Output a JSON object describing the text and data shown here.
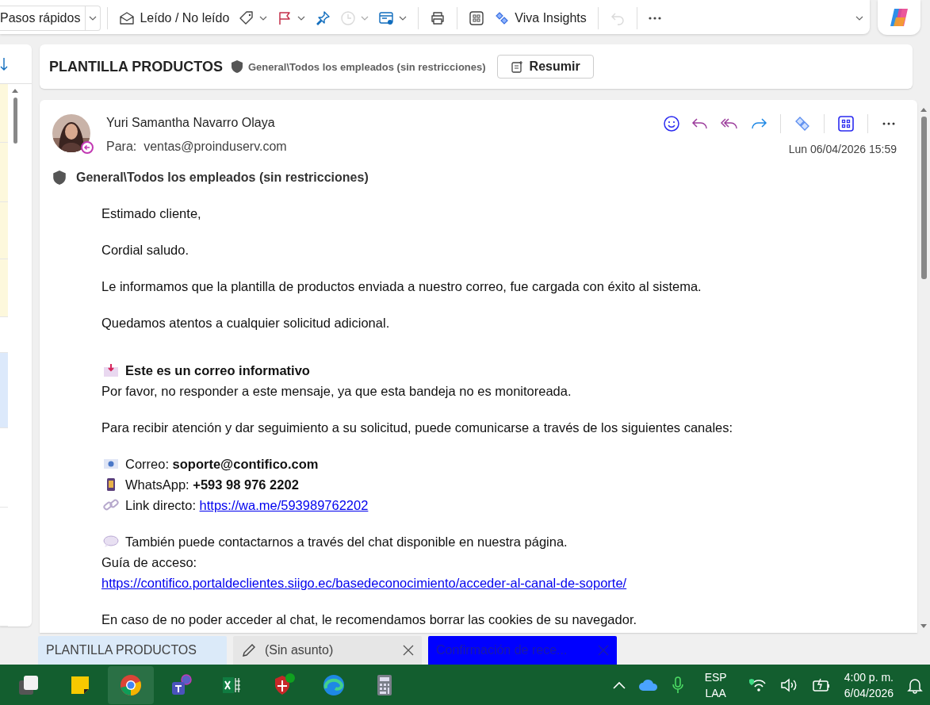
{
  "toolbar": {
    "groups": [
      {
        "items": [
          {
            "kind": "split",
            "label": "Pasos rápidos",
            "dropdown": true,
            "disabled": false
          }
        ]
      },
      {
        "items": [
          {
            "kind": "mail",
            "label": "Leído / No leído",
            "dropdown": false,
            "disabled": false
          },
          {
            "kind": "tag",
            "dropdown": true,
            "disabled": false
          },
          {
            "kind": "flag",
            "dropdown": true,
            "disabled": false
          },
          {
            "kind": "pin",
            "dropdown": false,
            "disabled": false
          },
          {
            "kind": "clock",
            "dropdown": true,
            "disabled": true
          },
          {
            "kind": "rules",
            "dropdown": true,
            "disabled": false
          }
        ]
      },
      {
        "items": [
          {
            "kind": "print",
            "dropdown": false,
            "disabled": false
          }
        ]
      },
      {
        "items": [
          {
            "kind": "apps",
            "dropdown": false,
            "disabled": false
          },
          {
            "kind": "viva",
            "label": "Viva Insights",
            "dropdown": false,
            "disabled": false
          }
        ]
      },
      {
        "items": [
          {
            "kind": "undo",
            "dropdown": false,
            "disabled": true
          }
        ]
      },
      {
        "items": [
          {
            "kind": "more",
            "dropdown": false,
            "disabled": false
          }
        ]
      }
    ]
  },
  "message_list": {
    "rows": [
      {
        "highlighted": true,
        "selected": false
      },
      {
        "highlighted": true,
        "selected": false
      },
      {
        "highlighted": true,
        "selected": false
      },
      {
        "highlighted": true,
        "selected": false
      },
      {
        "highlighted": false,
        "selected": false
      },
      {
        "highlighted": false,
        "selected": true
      },
      {
        "highlighted": false,
        "selected": false
      },
      {
        "highlighted": false,
        "selected": false
      }
    ]
  },
  "header": {
    "subject": "PLANTILLA PRODUCTOS",
    "sensitivity": "General\\Todos los empleados (sin restricciones)",
    "summarize_button": "Resumir"
  },
  "message": {
    "sender": "Yuri Samantha Navarro Olaya",
    "to_label": "Para:",
    "to": "ventas@proinduserv.com",
    "date": "Lun 06/04/2026 15:59",
    "sensitivity": "General\\Todos los empleados (sin restricciones)",
    "body": [
      {
        "lines": [
          {
            "kind": "text",
            "text": "Estimado cliente,"
          }
        ]
      },
      {
        "lines": [
          {
            "kind": "text",
            "text": "Cordial saludo."
          }
        ]
      },
      {
        "lines": [
          {
            "kind": "text",
            "text": "Le informamos que la plantilla de productos enviada a nuestro correo, fue cargada con éxito al sistema."
          }
        ]
      },
      {
        "lines": [
          {
            "kind": "text",
            "text": "Quedamos atentos a cualquier solicitud adicional."
          }
        ]
      },
      {
        "lines": [
          {
            "kind": "heading",
            "text": "Este es un correo informativo"
          },
          {
            "kind": "text",
            "text": "Por favor, no responder a este mensaje, ya que esta bandeja no es monitoreada."
          }
        ]
      },
      {
        "lines": [
          {
            "kind": "text",
            "text": "Para recibir atención y dar seguimiento a su solicitud, puede comunicarse a través de los siguientes canales:"
          }
        ]
      },
      {
        "lines": [
          {
            "kind": "email",
            "text": "Correo: **soporte@contifico.com**"
          },
          {
            "kind": "phone",
            "text": "WhatsApp: **+593 98 976 2202**"
          },
          {
            "kind": "chain",
            "text": "Link directo:",
            "link": "https://wa.me/593989762202"
          }
        ]
      },
      {
        "lines": [
          {
            "kind": "speech",
            "text": "También puede contactarnos a través del chat disponible en nuestra página."
          },
          {
            "kind": "text",
            "text": "Guía de acceso:"
          },
          {
            "kind": "url",
            "link": "https://contifico.portaldeclientes.siigo.ec/basedeconocimiento/acceder-al-canal-de-soporte/"
          }
        ]
      },
      {
        "lines": [
          {
            "kind": "text",
            "text": "En caso de no poder acceder al chat, le recomendamos borrar las cookies de su navegador."
          }
        ]
      }
    ]
  },
  "tabs": [
    {
      "kind": "message",
      "label": "PLANTILLA PRODUCTOS",
      "selected": true,
      "closable": false,
      "highlighted": false
    },
    {
      "kind": "draft",
      "label": "(Sin asunto)",
      "selected": false,
      "closable": true,
      "highlighted": false
    },
    {
      "kind": "message",
      "label": "Confirmación de rece...",
      "selected": false,
      "closable": true,
      "highlighted": true
    }
  ],
  "taskbar": {
    "apps": [
      {
        "kind": "desktop",
        "selected": false
      },
      {
        "kind": "notes",
        "selected": false
      },
      {
        "kind": "browser",
        "selected": true
      },
      {
        "kind": "teams",
        "selected": false
      },
      {
        "kind": "spreadsheet",
        "selected": false
      },
      {
        "kind": "shield",
        "selected": false
      },
      {
        "kind": "edge",
        "selected": false
      },
      {
        "kind": "calculator",
        "selected": false
      }
    ],
    "language": [
      "ESP",
      "LAA"
    ],
    "time": "4:00 p. m.",
    "date": "6/04/2026"
  }
}
